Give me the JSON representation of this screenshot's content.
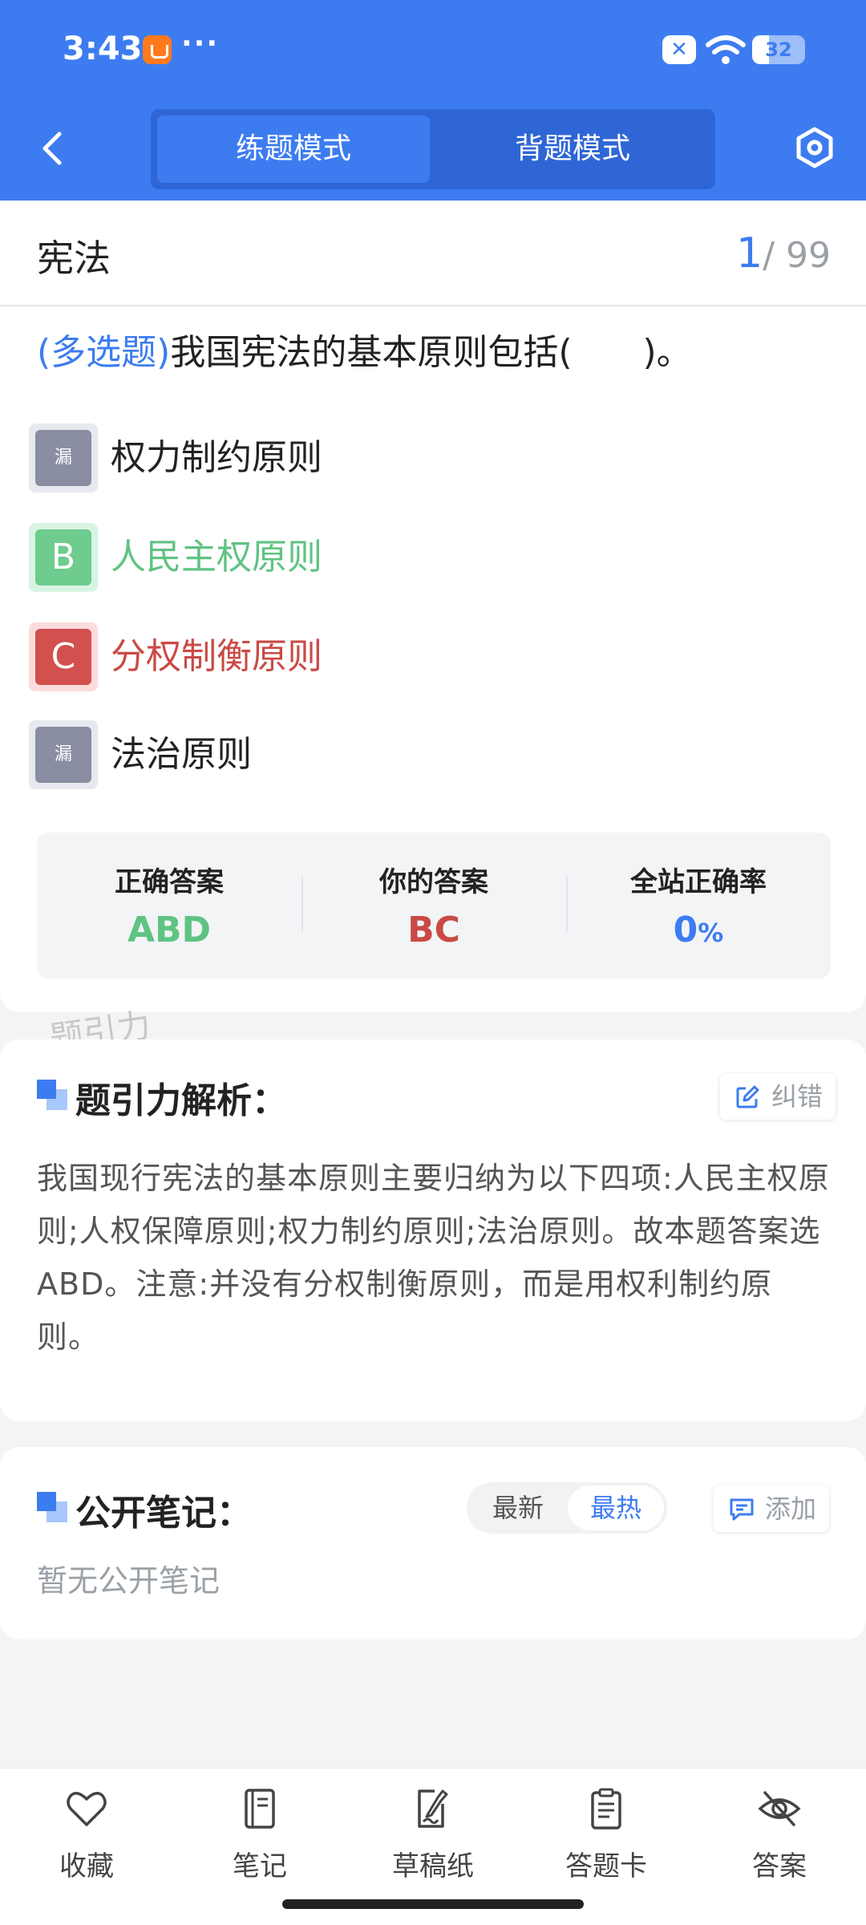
{
  "status_bar": {
    "time": "3:43",
    "more": "···",
    "battery": "32"
  },
  "header": {
    "tabs": [
      {
        "label": "练题模式",
        "active": true
      },
      {
        "label": "背题模式",
        "active": false
      }
    ]
  },
  "question": {
    "subject": "宪法",
    "current": "1",
    "total": "/ 99",
    "type_label": "(多选题)",
    "stem": "我国宪法的基本原则包括(　　)。",
    "options": [
      {
        "badge": "漏",
        "text": "权力制约原则",
        "state": "missed"
      },
      {
        "badge": "B",
        "text": "人民主权原则",
        "state": "correct"
      },
      {
        "badge": "C",
        "text": "分权制衡原则",
        "state": "wrong"
      },
      {
        "badge": "漏",
        "text": "法治原则",
        "state": "missed"
      }
    ]
  },
  "answers": {
    "correct_label": "正确答案",
    "correct_value": "ABD",
    "yours_label": "你的答案",
    "yours_value": "BC",
    "rate_label": "全站正确率",
    "rate_value": "0",
    "rate_unit": "%"
  },
  "watermark": "题引力",
  "analysis": {
    "title": "题引力解析：",
    "report_label": "纠错",
    "text": "我国现行宪法的基本原则主要归纳为以下四项:人民主权原则;人权保障原则;权力制约原则;法治原则。故本题答案选ABD。注意:并没有分权制衡原则，而是用权利制约原则。"
  },
  "notes": {
    "title": "公开笔记：",
    "sort_latest": "最新",
    "sort_hot": "最热",
    "add_label": "添加",
    "empty": "暂无公开笔记"
  },
  "bottom_nav": [
    {
      "label": "收藏",
      "icon": "heart-icon"
    },
    {
      "label": "笔记",
      "icon": "notebook-icon"
    },
    {
      "label": "草稿纸",
      "icon": "draft-icon"
    },
    {
      "label": "答题卡",
      "icon": "clipboard-icon"
    },
    {
      "label": "答案",
      "icon": "eye-off-icon"
    }
  ],
  "colors": {
    "primary": "#3d7cf0",
    "correct": "#5fc382",
    "wrong": "#c94a45",
    "missed": "#8a8ea3"
  }
}
